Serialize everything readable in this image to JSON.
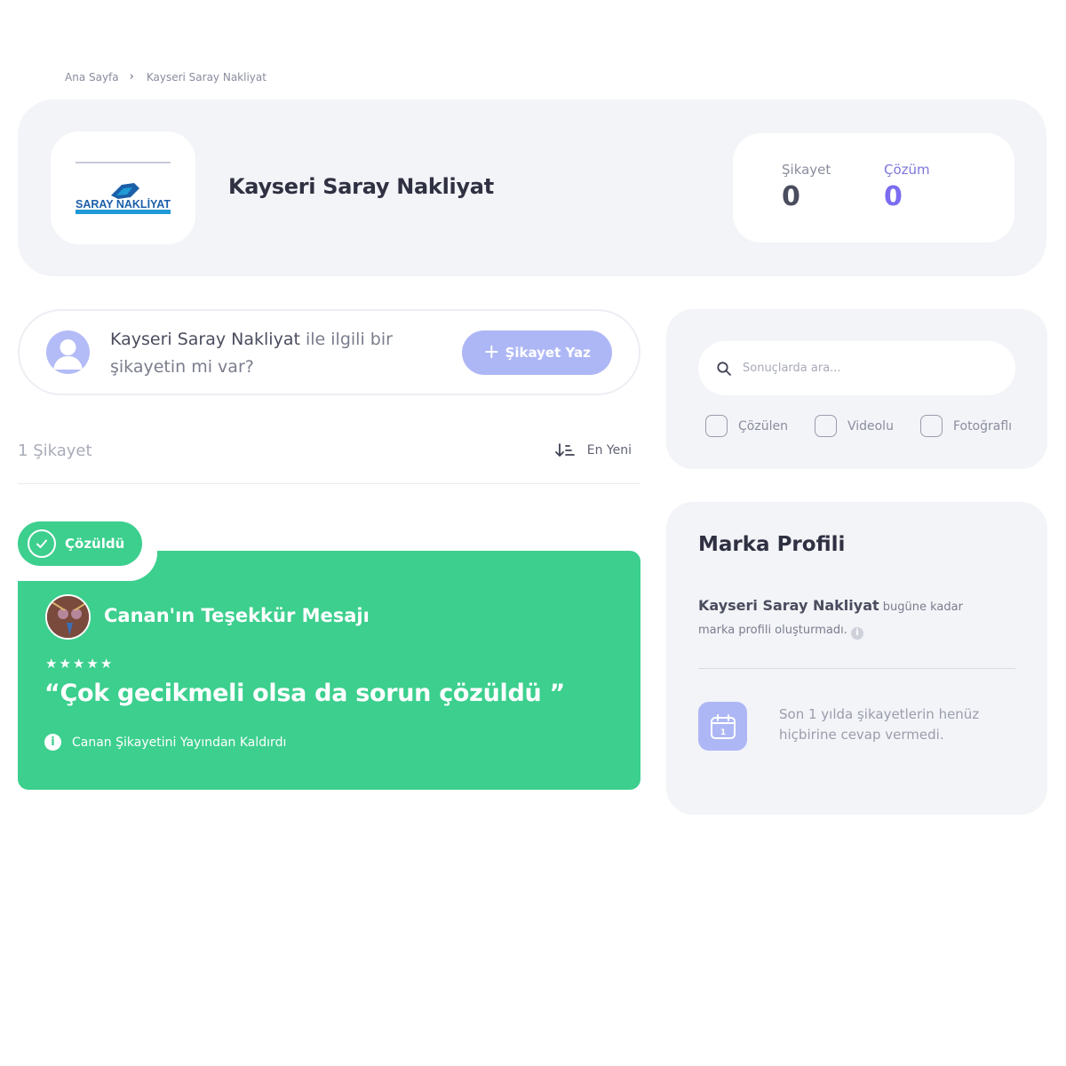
{
  "breadcrumb": {
    "home": "Ana Sayfa",
    "separator": "›",
    "current": "Kayseri Saray Nakliyat"
  },
  "brand": {
    "name": "Kayseri Saray Nakliyat",
    "logo_text": "SARAY NAKLİYAT",
    "logo_colors": {
      "primary": "#1b5fa8",
      "accent": "#1f9ad6"
    }
  },
  "stats": {
    "complaint_label": "Şikayet",
    "complaint_value": "0",
    "solution_label": "Çözüm",
    "solution_value": "0"
  },
  "ask": {
    "brand": "Kayseri Saray Nakliyat",
    "text": " ile ilgili bir şikayetin mi var?",
    "button_label": "Şikayet Yaz",
    "button_icon": "plus-icon"
  },
  "list": {
    "count": "1",
    "count_label": "Şikayet",
    "sort_label": "En Yeni",
    "sort_icon": "sort-descending-icon"
  },
  "complaint": {
    "badge": "Çözüldü",
    "title": "Canan'ın Teşekkür Mesajı",
    "rating": 5,
    "rating_max": 5,
    "quote": "“Çok gecikmeli olsa da sorun çözüldü ”",
    "removed_note": "Canan Şikayetini Yayından Kaldırdı",
    "color": "#3ccf8e"
  },
  "search": {
    "placeholder": "Sonuçlarda ara...",
    "filters": [
      "Çözülen",
      "Videolu",
      "Fotoğraflı"
    ]
  },
  "profile": {
    "title": "Marka Profili",
    "brand": "Kayseri Saray Nakliyat",
    "desc": " bugüne kadar marka profili oluşturmadı.",
    "calendar_day": "1",
    "response_note": "Son 1 yılda şikayetlerin henüz hiçbirine cevap vermedi."
  },
  "colors": {
    "accent_purple": "#7b6cf0",
    "button_lilac": "#aeb7f5",
    "panel_bg": "#f3f4f8",
    "success_green": "#3ccf8e"
  }
}
